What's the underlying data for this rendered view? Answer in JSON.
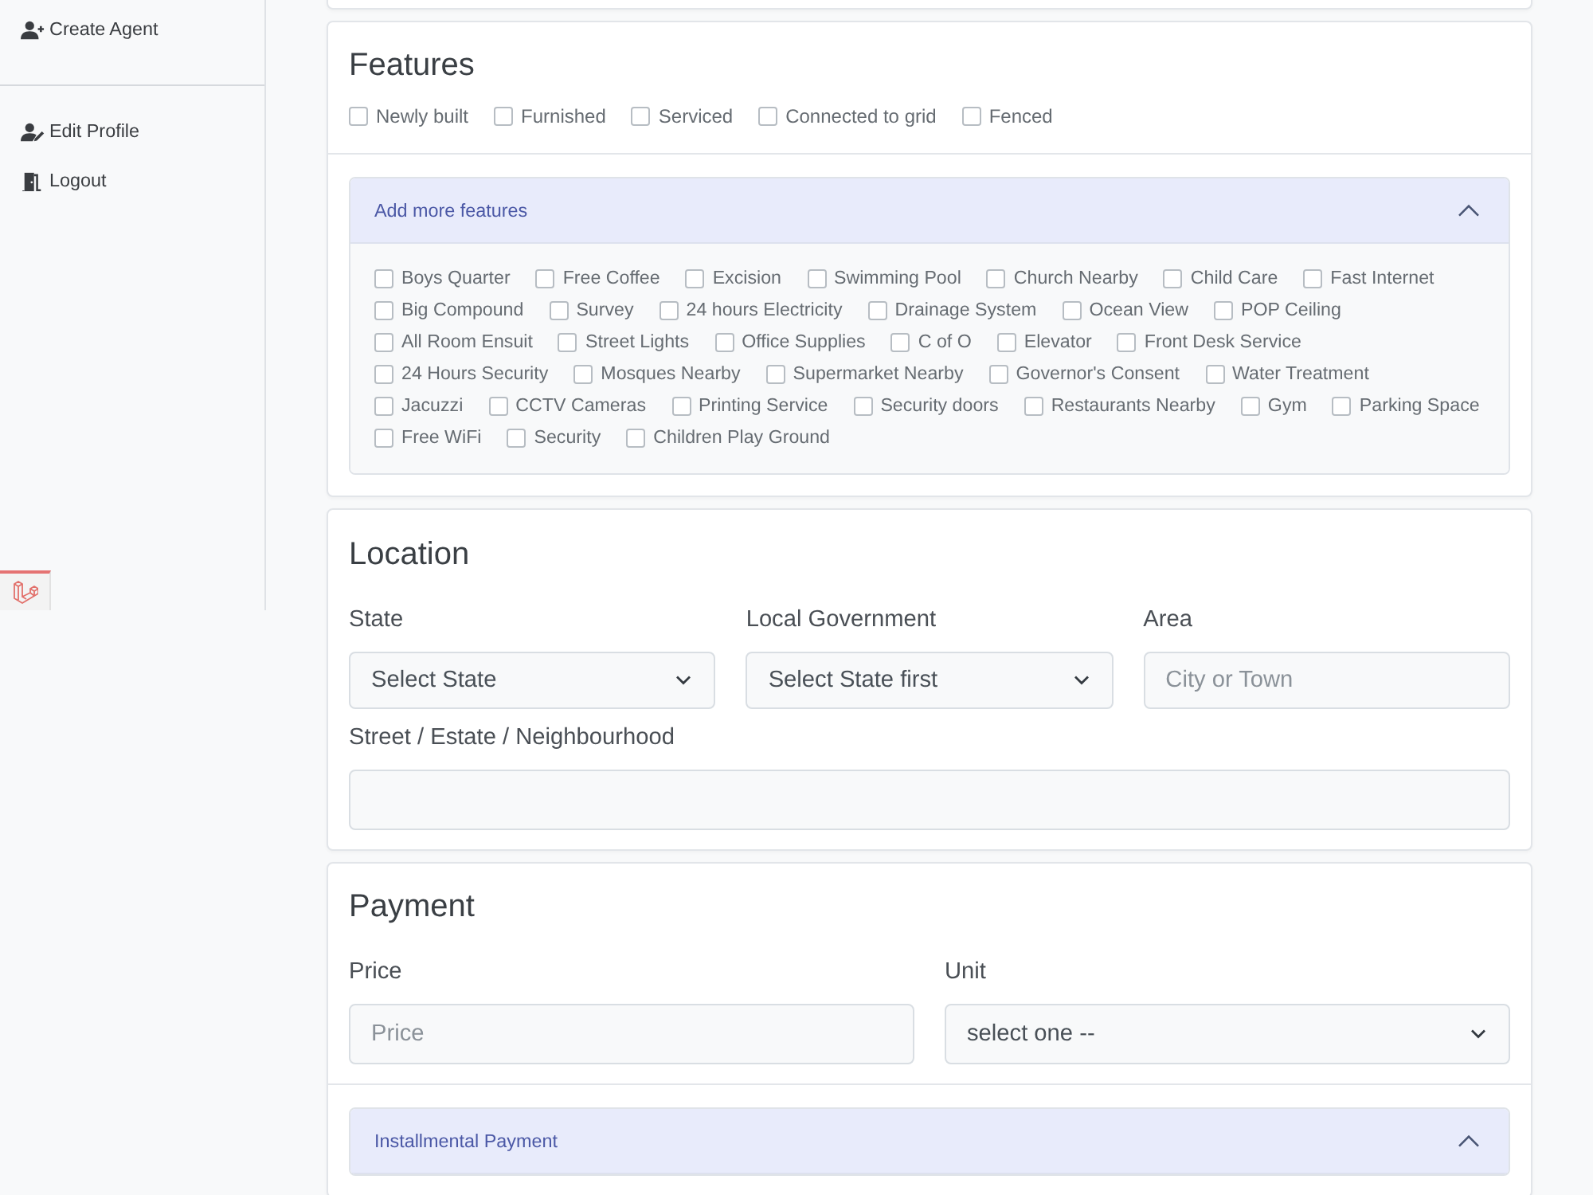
{
  "sidebar": {
    "groups": [
      {
        "items": [
          {
            "label": "Create Agent",
            "kind": "add-user"
          }
        ]
      },
      {
        "items": [
          {
            "label": "Edit Profile",
            "kind": "edit-user"
          },
          {
            "label": "Logout",
            "kind": "logout"
          }
        ]
      }
    ]
  },
  "features": {
    "title": "Features",
    "options": [
      {
        "label": "Newly built",
        "checked": false
      },
      {
        "label": "Furnished",
        "checked": false
      },
      {
        "label": "Serviced",
        "checked": false
      },
      {
        "label": "Connected to grid",
        "checked": false
      },
      {
        "label": "Fenced",
        "checked": false
      }
    ],
    "more": {
      "title": "Add more features",
      "expanded": true,
      "options": [
        {
          "label": "Boys Quarter",
          "checked": false
        },
        {
          "label": "Free Coffee",
          "checked": false
        },
        {
          "label": "Excision",
          "checked": false
        },
        {
          "label": "Swimming Pool",
          "checked": false
        },
        {
          "label": "Church Nearby",
          "checked": false
        },
        {
          "label": "Child Care",
          "checked": false
        },
        {
          "label": "Fast Internet",
          "checked": false
        },
        {
          "label": "Big Compound",
          "checked": false
        },
        {
          "label": "Survey",
          "checked": false
        },
        {
          "label": "24 hours Electricity",
          "checked": false
        },
        {
          "label": "Drainage System",
          "checked": false
        },
        {
          "label": "Ocean View",
          "checked": false
        },
        {
          "label": "POP Ceiling",
          "checked": false
        },
        {
          "label": "All Room Ensuit",
          "checked": false
        },
        {
          "label": "Street Lights",
          "checked": false
        },
        {
          "label": "Office Supplies",
          "checked": false
        },
        {
          "label": "C of O",
          "checked": false
        },
        {
          "label": "Elevator",
          "checked": false
        },
        {
          "label": "Front Desk Service",
          "checked": false
        },
        {
          "label": "24 Hours Security",
          "checked": false
        },
        {
          "label": "Mosques Nearby",
          "checked": false
        },
        {
          "label": "Supermarket Nearby",
          "checked": false
        },
        {
          "label": "Governor's Consent",
          "checked": false
        },
        {
          "label": "Water Treatment",
          "checked": false
        },
        {
          "label": "Jacuzzi",
          "checked": false
        },
        {
          "label": "CCTV Cameras",
          "checked": false
        },
        {
          "label": "Printing Service",
          "checked": false
        },
        {
          "label": "Security doors",
          "checked": false
        },
        {
          "label": "Restaurants Nearby",
          "checked": false
        },
        {
          "label": "Gym",
          "checked": false
        },
        {
          "label": "Parking Space",
          "checked": false
        },
        {
          "label": "Free WiFi",
          "checked": false
        },
        {
          "label": "Security",
          "checked": false
        },
        {
          "label": "Children Play Ground",
          "checked": false
        }
      ]
    }
  },
  "location": {
    "title": "Location",
    "fields": [
      {
        "label": "State",
        "kind": "select",
        "value": "Select State"
      },
      {
        "label": "Local Government",
        "kind": "select",
        "value": "Select State first"
      },
      {
        "label": "Area",
        "kind": "text",
        "placeholder": "City or Town"
      },
      {
        "label": "Street / Estate / Neighbourhood",
        "kind": "text"
      }
    ]
  },
  "payment": {
    "title": "Payment",
    "fields": [
      {
        "label": "Price",
        "kind": "text",
        "placeholder": "Price"
      },
      {
        "label": "Unit",
        "kind": "select",
        "value": "select one --"
      }
    ],
    "installments": {
      "title": "Installmental Payment",
      "expanded": true
    }
  }
}
